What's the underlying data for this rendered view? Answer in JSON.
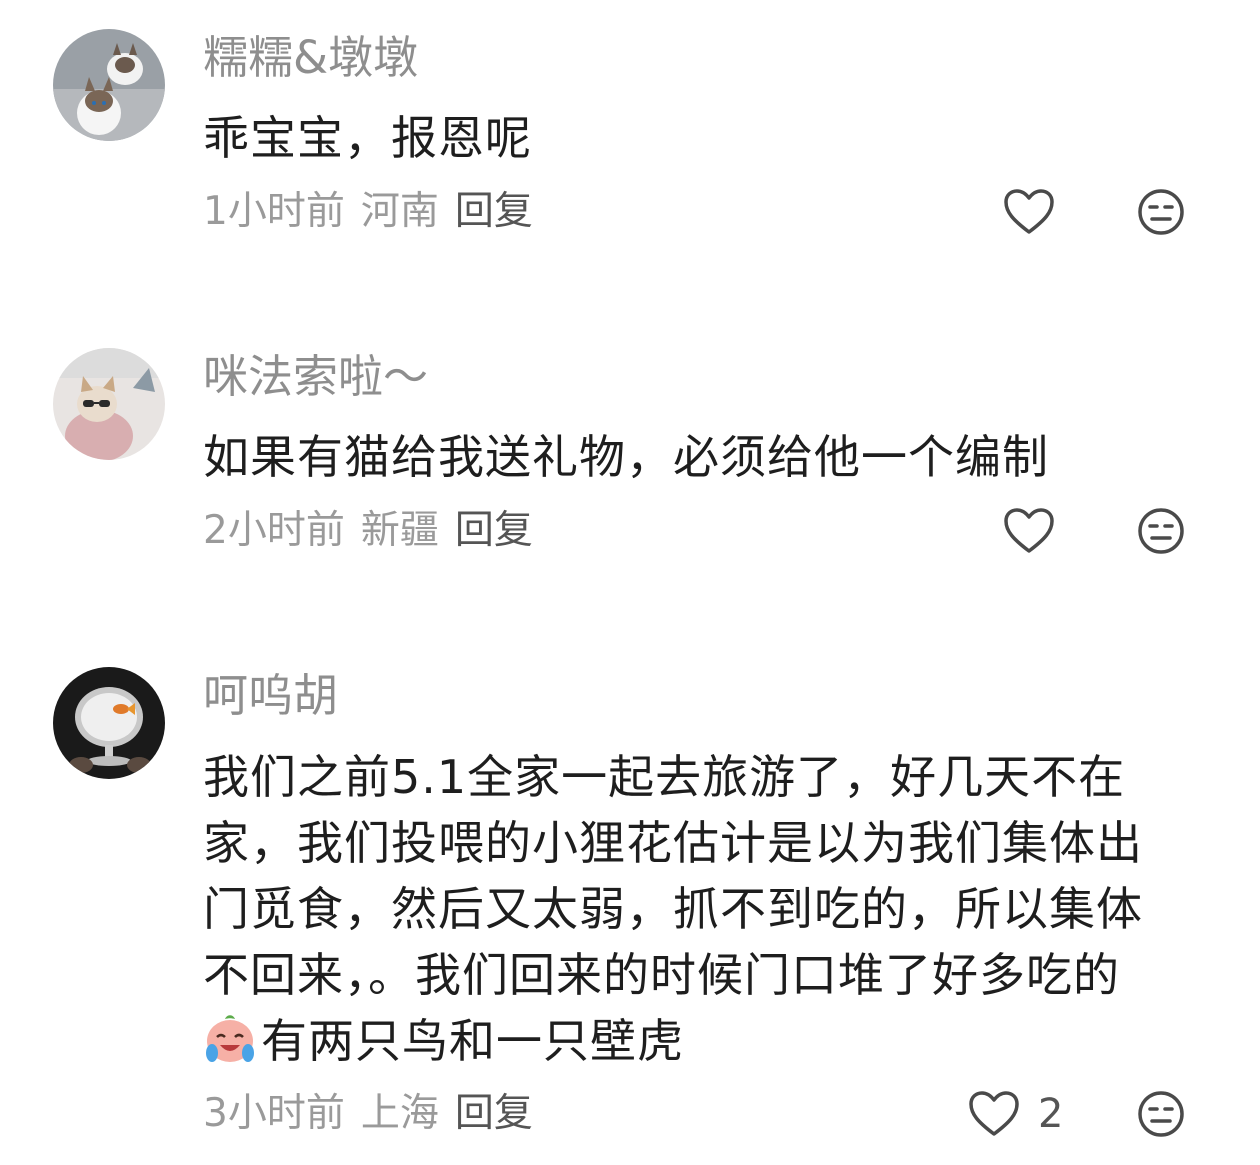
{
  "comments": [
    {
      "username": "糯糯&墩墩",
      "text": "乖宝宝，报恩呢",
      "time": "1小时前",
      "location": "河南",
      "reply_label": "回复",
      "avatar_icon": "cats-avatar"
    },
    {
      "username": "咪法索啦～",
      "text": "如果有猫给我送礼物，必须给他一个编制",
      "time": "2小时前",
      "location": "新疆",
      "reply_label": "回复",
      "avatar_icon": "cat-sunglasses-avatar"
    },
    {
      "username": "呵呜胡",
      "text_lines": [
        "我们之前5.1全家一起去旅游了，好几天不在",
        "家，我们投喂的小狸花估计是以为我们集体出",
        "门觅食，然后又太弱，抓不到吃的，所以集体",
        "不回来，。我们回来的时候门口堆了好多吃的",
        "有两只鸟和一只壁虎"
      ],
      "time": "3小时前",
      "location": "上海",
      "reply_label": "回复",
      "like_count": "2",
      "avatar_icon": "fish-bowl-avatar",
      "inline_emoji": "crying-laughing-emoji"
    }
  ],
  "icons": {
    "like": "heart-outline-icon",
    "dislike": "meh-face-icon"
  },
  "colors": {
    "username": "#8e8e8e",
    "text": "#1e1e1e",
    "meta": "#9a9a9a",
    "icon": "#4a4a4a"
  }
}
